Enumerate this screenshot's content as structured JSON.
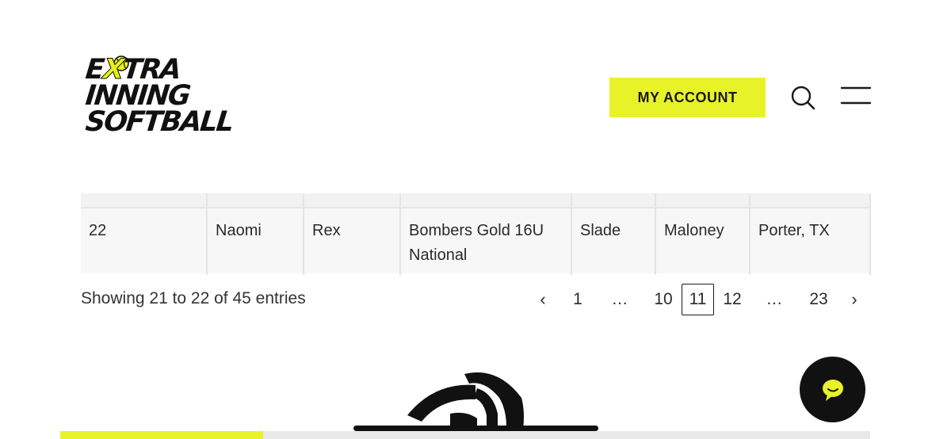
{
  "header": {
    "logo_lines": [
      "E",
      "X",
      "TRA",
      "INNING",
      "SOFTBALL"
    ],
    "account_label": "MY ACCOUNT",
    "accent_color": "#e8f229"
  },
  "table": {
    "row": {
      "number": "22",
      "first_name": "Naomi",
      "last_name": "Rex",
      "team": "Bombers Gold 16U National",
      "coach_first": "Slade",
      "coach_last": "Maloney",
      "location": "Porter, TX"
    }
  },
  "footer_info": {
    "entries_text": "Showing 21 to 22 of 45 entries"
  },
  "pagination": {
    "prev": "‹",
    "items": [
      "1",
      "…",
      "10",
      "11",
      "12",
      "…",
      "23"
    ],
    "current": "11",
    "next": "›"
  },
  "bottom": {
    "progress_fraction": 0.25
  }
}
